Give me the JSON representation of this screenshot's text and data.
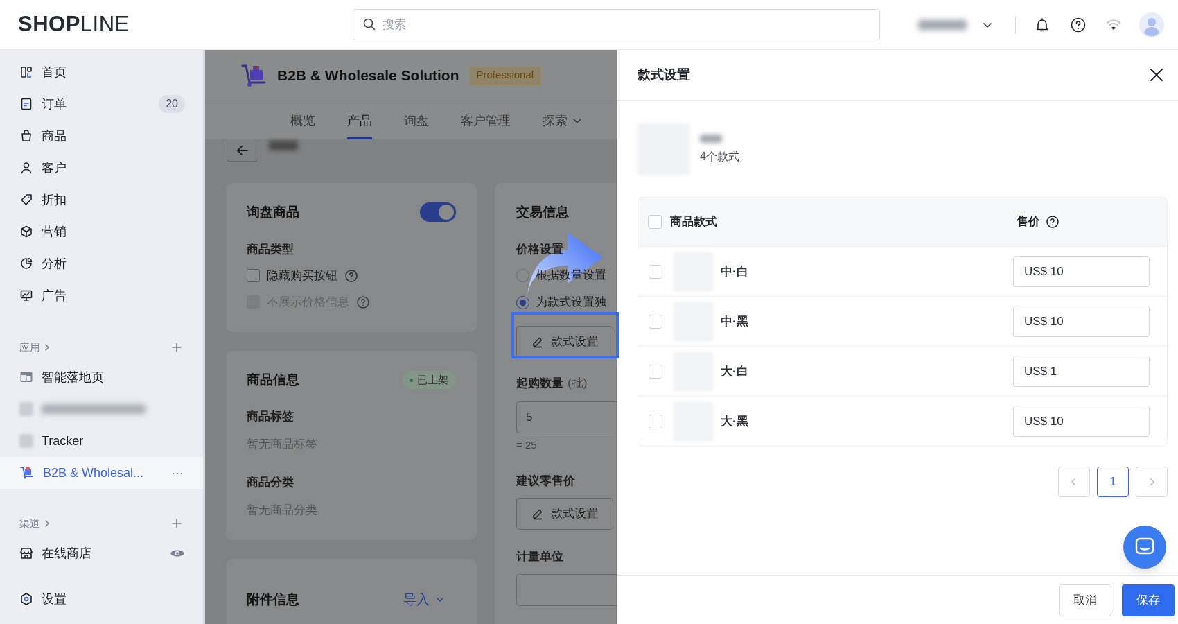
{
  "header": {
    "logo": "**SHOP**LINE",
    "search": {
      "placeholder": "搜索"
    }
  },
  "sidebar": {
    "items": [
      {
        "label": "首页",
        "selected": false
      },
      {
        "label": "订单",
        "badge": "20",
        "selected": false
      },
      {
        "label": "商品",
        "selected": false
      },
      {
        "label": "客户",
        "selected": false
      },
      {
        "label": "折扣",
        "selected": false
      },
      {
        "label": "营销",
        "selected": false
      },
      {
        "label": "分析",
        "selected": false
      },
      {
        "label": "广告",
        "selected": false
      }
    ],
    "apps": {
      "title": "应用",
      "items": [
        {
          "kind": "app",
          "label": "智能落地页",
          "selected": false
        },
        {
          "kind": "redacted"
        },
        {
          "kind": "app",
          "label": "Tracker",
          "selected": false
        },
        {
          "kind": "app",
          "label": "B2B & Wholesal...",
          "selected": true,
          "more": "⋯"
        }
      ]
    },
    "channels": {
      "title": "渠道",
      "items": [
        {
          "label": "在线商店"
        }
      ]
    },
    "settings": {
      "label": "设置"
    }
  },
  "app": {
    "title": "B2B & Wholesale Solution",
    "badge": "Professional",
    "tabs": [
      {
        "kind": "tab",
        "label": "概览",
        "selected": false
      },
      {
        "kind": "tab",
        "label": "产品",
        "selected": true
      },
      {
        "kind": "tab",
        "label": "询盘",
        "selected": false
      },
      {
        "kind": "tab",
        "label": "客户管理",
        "selected": false
      },
      {
        "kind": "menu",
        "label": "探索",
        "selected": false
      }
    ]
  },
  "inquiry": {
    "title": "询盘商品",
    "enabled": true,
    "type_label": "商品类型",
    "options": [
      {
        "label": "隐藏购买按钮",
        "checked": false,
        "disabled": false
      },
      {
        "label": "不展示价格信息",
        "checked": false,
        "disabled": true
      }
    ]
  },
  "product_info": {
    "title": "商品信息",
    "status": "已上架",
    "fields": [
      {
        "label": "商品标签",
        "value": "暂无商品标签"
      },
      {
        "label": "商品分类",
        "value": "暂无商品分类"
      }
    ]
  },
  "attachments": {
    "title": "附件信息",
    "action": "导入"
  },
  "trade": {
    "title": "交易信息",
    "price_label": "价格设置",
    "price_options": [
      {
        "label": "根据数量设置",
        "selected": false
      },
      {
        "label": "为款式设置独",
        "selected": true
      }
    ],
    "variant_button": "款式设置",
    "moq_label": "起购数量",
    "moq_unit": "(批)",
    "moq_value": "5",
    "moq_total": "= 25",
    "retail_label": "建议零售价",
    "retail_button": "款式设置",
    "unit_label": "计量单位"
  },
  "drawer": {
    "title": "款式设置",
    "variant_count": "4个款式",
    "table": {
      "all_checked": false,
      "columns": [
        "商品款式",
        "售价"
      ],
      "rows": [
        {
          "name": "中·白",
          "price": "US$ 10",
          "checked": false
        },
        {
          "name": "中·黑",
          "price": "US$ 10",
          "checked": false
        },
        {
          "name": "大·白",
          "price": "US$ 1",
          "checked": false
        },
        {
          "name": "大·黑",
          "price": "US$ 10",
          "checked": false
        }
      ]
    },
    "pagination": {
      "pages": [
        {
          "label": "1",
          "selected": true
        }
      ]
    },
    "buttons": [
      {
        "label": "取消",
        "kind": "secondary"
      },
      {
        "label": "保存",
        "kind": "primary"
      }
    ]
  }
}
